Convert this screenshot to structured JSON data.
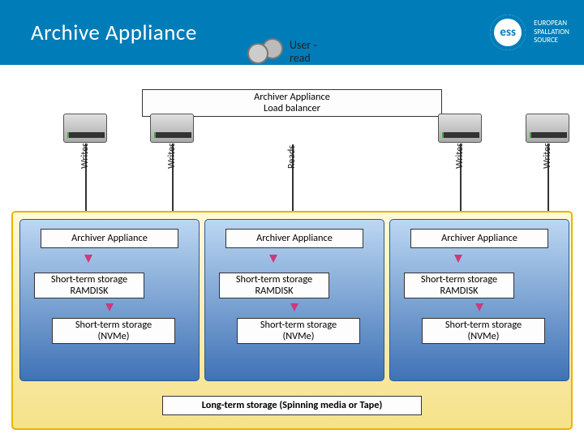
{
  "header": {
    "title": "Archive Appliance"
  },
  "brand": {
    "abbr": "ess",
    "full": "EUROPEAN\nSPALLATION\nSOURCE"
  },
  "user": {
    "label": "User -\nread"
  },
  "load_balancer": "Archiver Appliance\nLoad balancer",
  "vlines": {
    "l1": "Writes",
    "l2": "Writes",
    "l3": "Reads",
    "l4": "Writes",
    "l5": "Writes"
  },
  "columns": [
    {
      "appliance": "Archiver Appliance",
      "ramdisk": "Short-term storage\nRAMDISK",
      "nvme": "Short-term storage\n(NVMe)"
    },
    {
      "appliance": "Archiver Appliance",
      "ramdisk": "Short-term storage\nRAMDISK",
      "nvme": "Short-term storage\n(NVMe)"
    },
    {
      "appliance": "Archiver Appliance",
      "ramdisk": "Short-term storage\nRAMDISK",
      "nvme": "Short-term storage\n(NVMe)"
    }
  ],
  "long_term": "Long-term storage (Spinning media or Tape)",
  "colors": {
    "brand": "#007db8",
    "bigbox_border": "#e8b400",
    "arrow": "#cc3a7b"
  }
}
